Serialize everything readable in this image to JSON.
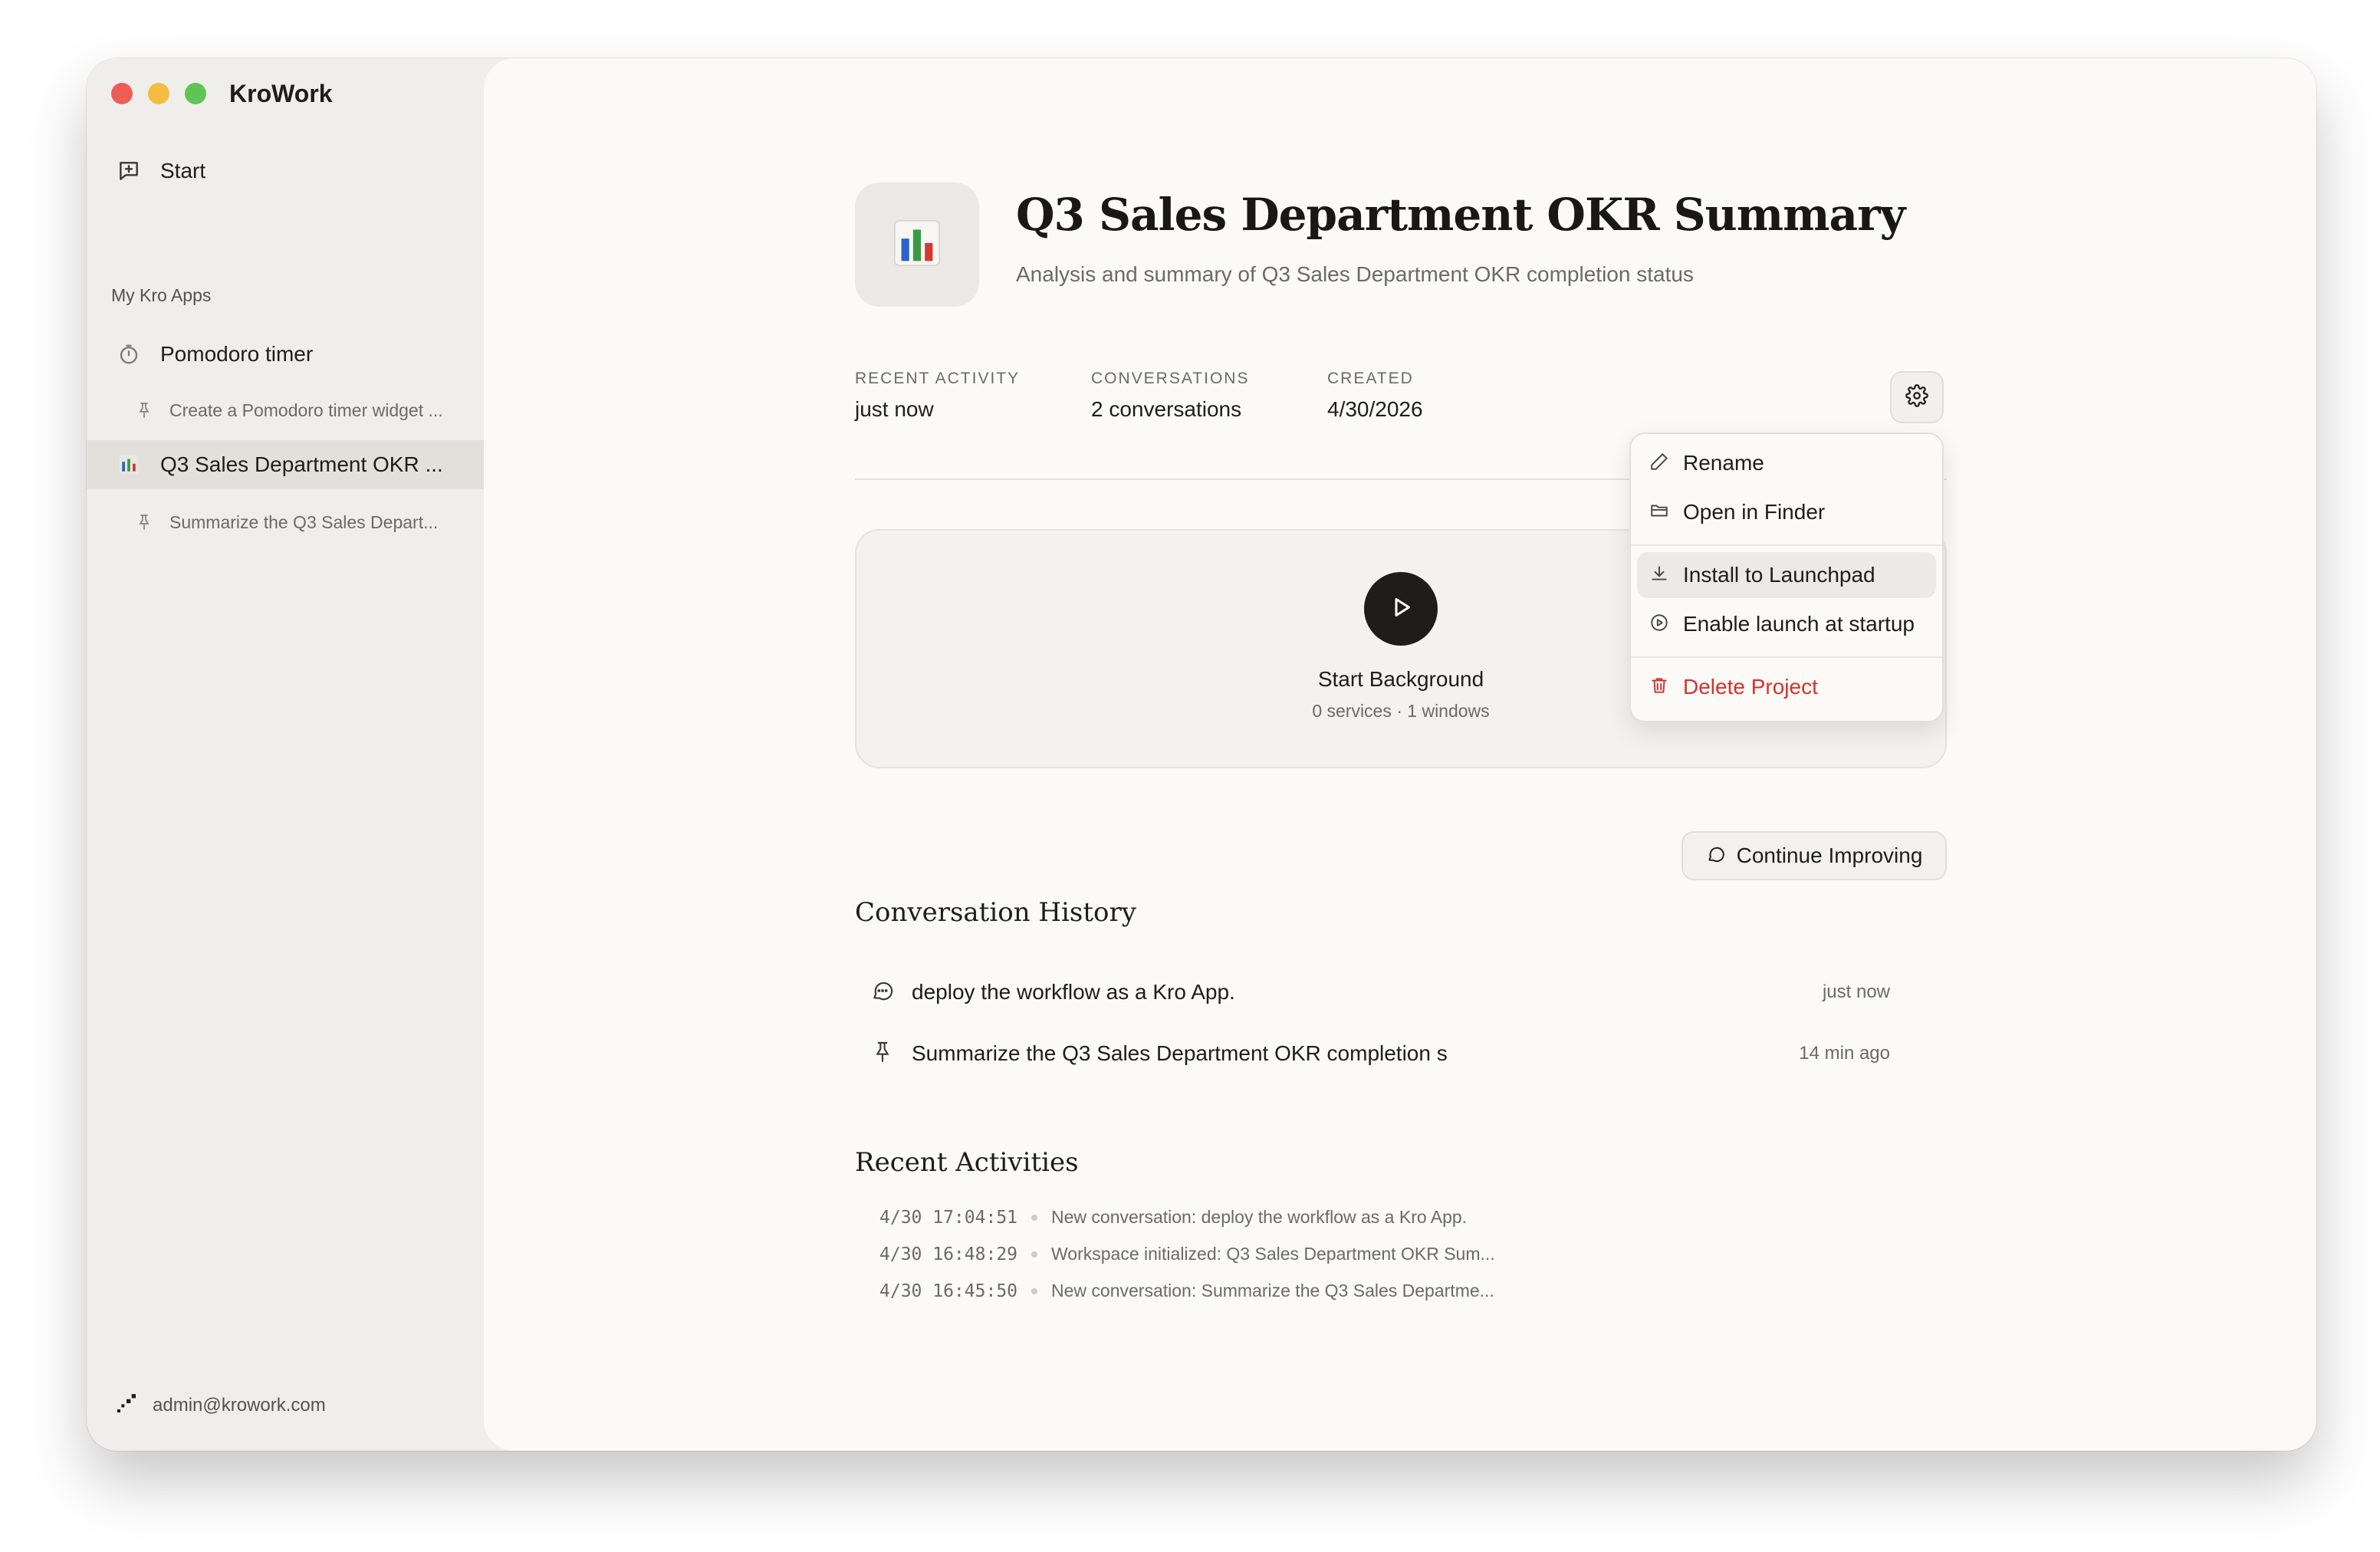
{
  "window": {
    "app_name": "KroWork"
  },
  "sidebar": {
    "start_label": "Start",
    "section_label": "My Kro Apps",
    "apps": [
      {
        "label": "Pomodoro timer",
        "icon": "timer-icon",
        "sub": "Create a Pomodoro timer widget ..."
      },
      {
        "label": "Q3 Sales Department OKR ...",
        "icon": "bar-chart-icon",
        "sub": "Summarize the Q3 Sales Depart..."
      }
    ],
    "user_email": "admin@krowork.com"
  },
  "project": {
    "title": "Q3 Sales Department OKR Summary",
    "subtitle": "Analysis and summary of Q3 Sales Department OKR completion status",
    "stats": [
      {
        "key": "RECENT ACTIVITY",
        "value": "just now"
      },
      {
        "key": "CONVERSATIONS",
        "value": "2 conversations"
      },
      {
        "key": "CREATED",
        "value": "4/30/2026"
      }
    ]
  },
  "background": {
    "title": "Start Background",
    "subtitle": "0 services · 1 windows"
  },
  "menu": {
    "rename": "Rename",
    "open_finder": "Open in Finder",
    "install": "Install to Launchpad",
    "startup": "Enable launch at startup",
    "delete": "Delete Project"
  },
  "history": {
    "heading": "Conversation History",
    "continue_label": "Continue Improving",
    "items": [
      {
        "text": "deploy the workflow as a Kro App.",
        "time": "just now",
        "icon": "chat-bubble-icon"
      },
      {
        "text": "Summarize the Q3 Sales Department OKR completion s",
        "time": "14 min ago",
        "icon": "pin-icon"
      }
    ]
  },
  "activities": {
    "heading": "Recent Activities",
    "items": [
      {
        "time": "4/30 17:04:51",
        "text": "New conversation: deploy the workflow as a Kro App."
      },
      {
        "time": "4/30 16:48:29",
        "text": "Workspace initialized: Q3 Sales Department OKR Sum..."
      },
      {
        "time": "4/30 16:45:50",
        "text": "New conversation: Summarize the Q3 Sales Departme..."
      }
    ]
  },
  "colors": {
    "accent_danger": "#d6322c",
    "play_button": "#1f1d1a",
    "menu_highlight": "#eceae6"
  }
}
